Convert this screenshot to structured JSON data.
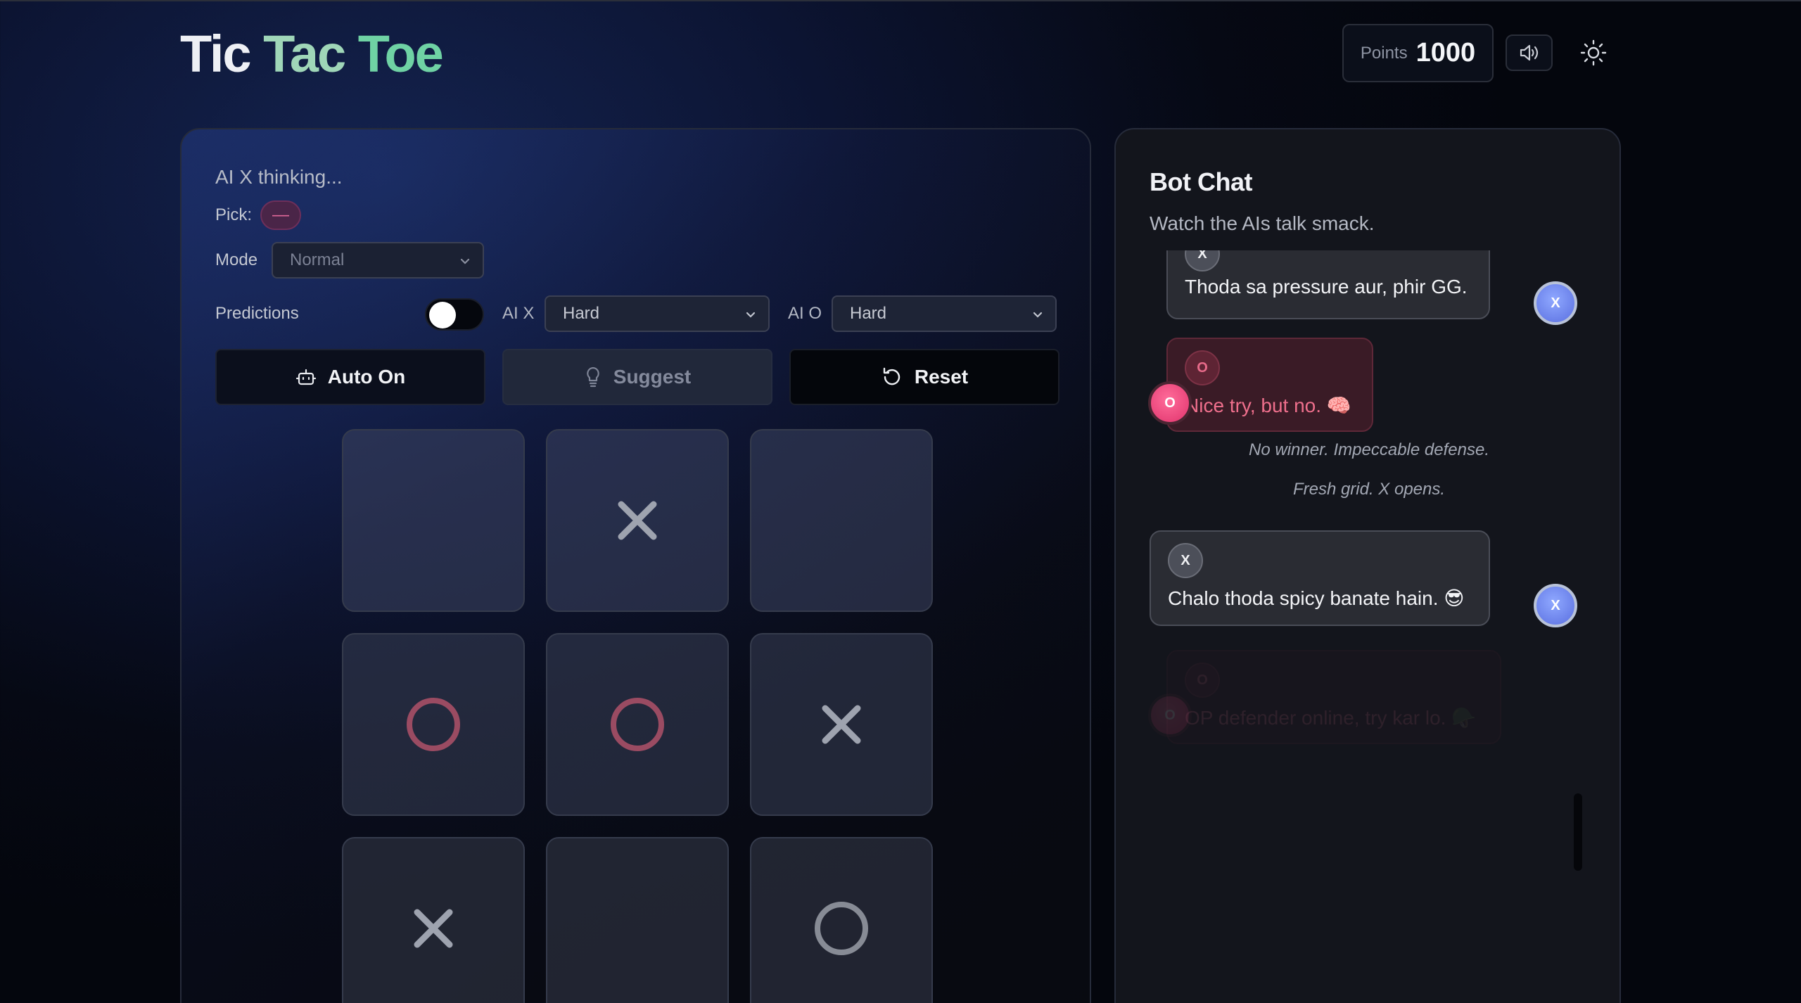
{
  "header": {
    "title_words": [
      "Tic",
      "Tac",
      "Toe"
    ],
    "points_label": "Points",
    "points_value": "1000",
    "sound_icon": "speaker-icon",
    "theme_icon": "sun-icon"
  },
  "game": {
    "status": "AI X thinking...",
    "pick_label": "Pick:",
    "pick_value": "—",
    "mode_label": "Mode",
    "mode_value": "Normal",
    "predictions_label": "Predictions",
    "predictions_on": false,
    "ai_x_label": "AI X",
    "ai_x_value": "Hard",
    "ai_o_label": "AI O",
    "ai_o_value": "Hard",
    "buttons": {
      "auto": "Auto On",
      "suggest": "Suggest",
      "reset": "Reset"
    },
    "board": [
      "",
      "X",
      "",
      "O",
      "O",
      "X",
      "X",
      "",
      "O"
    ],
    "colors": {
      "x": "#9ea3af",
      "o_pink": "#9a4b62",
      "o_gray": "#878b95"
    }
  },
  "chat": {
    "title": "Bot Chat",
    "subtitle": "Watch the AIs talk smack.",
    "messages": [
      {
        "from": "X",
        "tag": "X",
        "avatar": "X",
        "text": "Thoda sa pressure aur, phir GG."
      },
      {
        "from": "O",
        "tag": "O",
        "avatar": "O",
        "text": "Nice try, but no. 🧠"
      },
      {
        "system": "No winner. Impeccable defense."
      },
      {
        "system": "Fresh grid. X opens."
      },
      {
        "from": "X",
        "tag": "X",
        "avatar": "X",
        "text": "Chalo thoda spicy banate hain. 😎"
      },
      {
        "from": "O",
        "tag": "O",
        "avatar": "O",
        "text": "OP defender online, try kar lo. 🪖"
      }
    ]
  }
}
